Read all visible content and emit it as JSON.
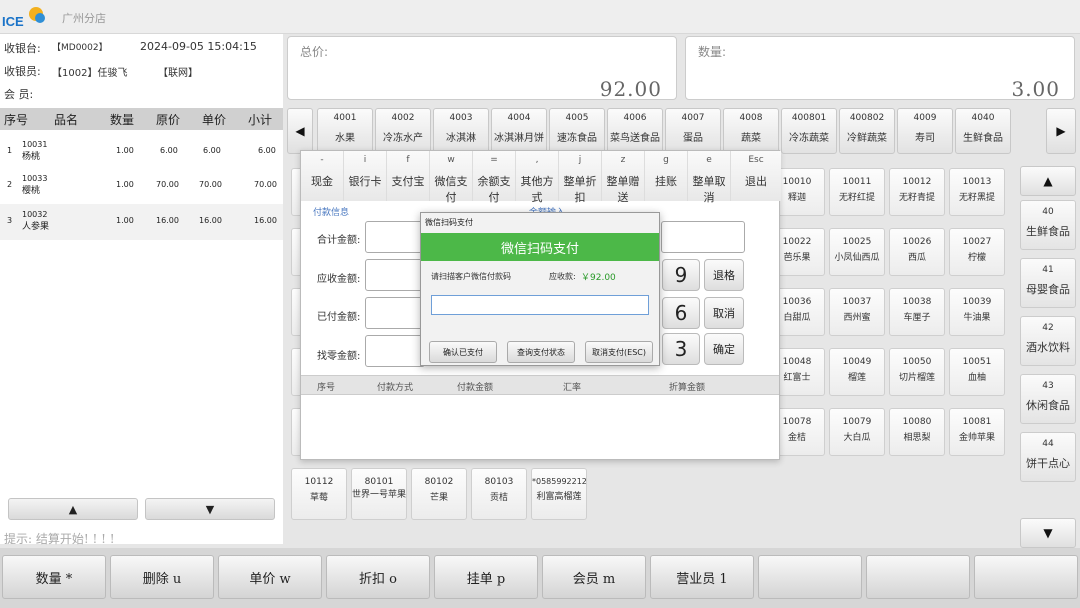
{
  "header": {
    "store": "广州分店"
  },
  "cashier": {
    "register_label": "收银台:",
    "register_value": "【MD0002】",
    "datetime": "2024-09-05 15:04:15",
    "operator_label": "收银员:",
    "operator_value": "【1002】任骏飞",
    "network": "【联网】",
    "member_label": "会 员:"
  },
  "cart": {
    "headers": [
      "序号",
      "品名",
      "数量",
      "原价",
      "单价",
      "小计"
    ],
    "rows": [
      {
        "no": "1",
        "code": "10031",
        "name": "杨桃",
        "qty": "1.00",
        "orig": "6.00",
        "price": "6.00",
        "sub": "6.00"
      },
      {
        "no": "2",
        "code": "10033",
        "name": "樱桃",
        "qty": "1.00",
        "orig": "70.00",
        "price": "70.00",
        "sub": "70.00"
      },
      {
        "no": "3",
        "code": "10032",
        "name": "人参果",
        "qty": "1.00",
        "orig": "16.00",
        "price": "16.00",
        "sub": "16.00"
      }
    ],
    "hint": "提示: 结算开始! ! ! !"
  },
  "totals": {
    "total_label": "总价:",
    "total_value": "92.00",
    "qty_label": "数量:",
    "qty_value": "3.00"
  },
  "categories": [
    {
      "code": "4001",
      "name": "水果"
    },
    {
      "code": "4002",
      "name": "冷冻水产"
    },
    {
      "code": "4003",
      "name": "冰淇淋"
    },
    {
      "code": "4004",
      "name": "冰淇淋月饼"
    },
    {
      "code": "4005",
      "name": "速冻食品"
    },
    {
      "code": "4006",
      "name": "菜鸟送食品"
    },
    {
      "code": "4007",
      "name": "蛋品"
    },
    {
      "code": "4008",
      "name": "蔬菜"
    },
    {
      "code": "400801",
      "name": "冷冻蔬菜"
    },
    {
      "code": "400802",
      "name": "冷鲜蔬菜"
    },
    {
      "code": "4009",
      "name": "寿司"
    },
    {
      "code": "4040",
      "name": "生鲜食品"
    }
  ],
  "side_categories": [
    {
      "code": "40",
      "name": "生鲜食品"
    },
    {
      "code": "41",
      "name": "母婴食品"
    },
    {
      "code": "42",
      "name": "酒水饮料"
    },
    {
      "code": "43",
      "name": "休闲食品"
    },
    {
      "code": "44",
      "name": "饼干点心"
    }
  ],
  "products": [
    {
      "code": "10010",
      "name": "释迦"
    },
    {
      "code": "10011",
      "name": "无籽红提"
    },
    {
      "code": "10012",
      "name": "无籽青提"
    },
    {
      "code": "10013",
      "name": "无籽黑提"
    },
    {
      "code": "10022",
      "name": "芭乐果"
    },
    {
      "code": "10025",
      "name": "小凤仙西瓜"
    },
    {
      "code": "10026",
      "name": "西瓜"
    },
    {
      "code": "10027",
      "name": "柠檬"
    },
    {
      "code": "10036",
      "name": "白甜瓜"
    },
    {
      "code": "10037",
      "name": "西州蜜"
    },
    {
      "code": "10038",
      "name": "车厘子"
    },
    {
      "code": "10039",
      "name": "牛油果"
    },
    {
      "code": "10048",
      "name": "红富士"
    },
    {
      "code": "10049",
      "name": "榴莲"
    },
    {
      "code": "10050",
      "name": "切片榴莲"
    },
    {
      "code": "10051",
      "name": "血柚"
    },
    {
      "code": "10078",
      "name": "金桔"
    },
    {
      "code": "10079",
      "name": "大白瓜"
    },
    {
      "code": "10080",
      "name": "相思梨"
    },
    {
      "code": "10081",
      "name": "金帅苹果"
    }
  ],
  "bottom_products": [
    {
      "code": "10112",
      "name": "草莓"
    },
    {
      "code": "80101",
      "name": "世界一号苹果"
    },
    {
      "code": "80102",
      "name": "芒果"
    },
    {
      "code": "80103",
      "name": "贡桔"
    },
    {
      "code": "*0585992212",
      "name": "利富高榴莲"
    }
  ],
  "payment": {
    "methods": [
      {
        "key": "-",
        "label": "现金"
      },
      {
        "key": "i",
        "label": "银行卡"
      },
      {
        "key": "f",
        "label": "支付宝"
      },
      {
        "key": "w",
        "label": "微信支付"
      },
      {
        "key": "=",
        "label": "余额支付"
      },
      {
        "key": ",",
        "label": "其他方式"
      },
      {
        "key": "j",
        "label": "整单折扣"
      },
      {
        "key": "z",
        "label": "整单赠送"
      },
      {
        "key": "g",
        "label": "挂账"
      },
      {
        "key": "e",
        "label": "整单取消"
      },
      {
        "key": "Esc",
        "label": "退出"
      }
    ],
    "info_title": "付款信息",
    "amount_title": "金额输入",
    "fields": [
      "合计金额:",
      "应收金额:",
      "已付金额:",
      "找零金额:"
    ],
    "keys": [
      "9",
      "6",
      "3"
    ],
    "actions": [
      "退格",
      "取消",
      "确定"
    ],
    "table_headers": [
      "序号",
      "付款方式",
      "付款金额",
      "汇率",
      "折算金额"
    ]
  },
  "wechat": {
    "window_title": "微信扫码支付",
    "banner": "微信扫码支付",
    "prompt": "请扫描客户微信付款码",
    "due_label": "应收款:",
    "due_value": "￥92.00",
    "buttons": [
      "确认已支付",
      "查询支付状态",
      "取消支付(ESC)"
    ]
  },
  "function_keys": [
    "数量 *",
    "删除 u",
    "单价 w",
    "折扣 o",
    "挂单 p",
    "会员 m",
    "营业员 1"
  ],
  "colors": {
    "wechat_green": "#4cb848",
    "accent_green": "#2a9a2a"
  }
}
